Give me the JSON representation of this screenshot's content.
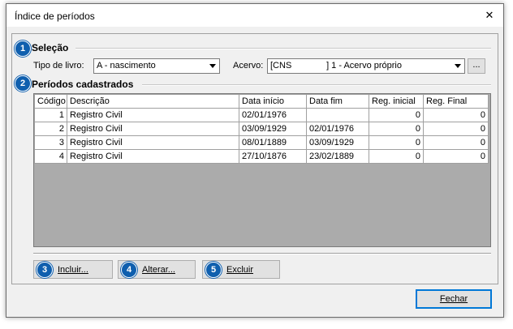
{
  "window": {
    "title": "Índice de períodos",
    "close_glyph": "✕"
  },
  "selecao": {
    "badge": "1",
    "title": "Seleção",
    "tipo_label": "Tipo de livro:",
    "tipo_value": "A - nascimento",
    "acervo_label": "Acervo:",
    "acervo_value": "[CNS              ] 1 - Acervo próprio",
    "browse_label": "..."
  },
  "periodos": {
    "badge": "2",
    "title": "Períodos cadastrados",
    "columns": [
      "Código",
      "Descrição",
      "Data início",
      "Data fim",
      "Reg. inicial",
      "Reg. Final"
    ],
    "rows": [
      [
        "1",
        "Registro Civil",
        "02/01/1976",
        "",
        "0",
        "0"
      ],
      [
        "2",
        "Registro Civil",
        "03/09/1929",
        "02/01/1976",
        "0",
        "0"
      ],
      [
        "3",
        "Registro Civil",
        "08/01/1889",
        "03/09/1929",
        "0",
        "0"
      ],
      [
        "4",
        "Registro Civil",
        "27/10/1876",
        "23/02/1889",
        "0",
        "0"
      ]
    ]
  },
  "actions": {
    "incluir": {
      "badge": "3",
      "label": "Incluir..."
    },
    "alterar": {
      "badge": "4",
      "label": "Alterar..."
    },
    "excluir": {
      "badge": "5",
      "label": "Excluir"
    }
  },
  "footer": {
    "fechar_label": "Fechar"
  },
  "colors": {
    "badge": "#0f5fae",
    "focus_border": "#0078d7"
  }
}
